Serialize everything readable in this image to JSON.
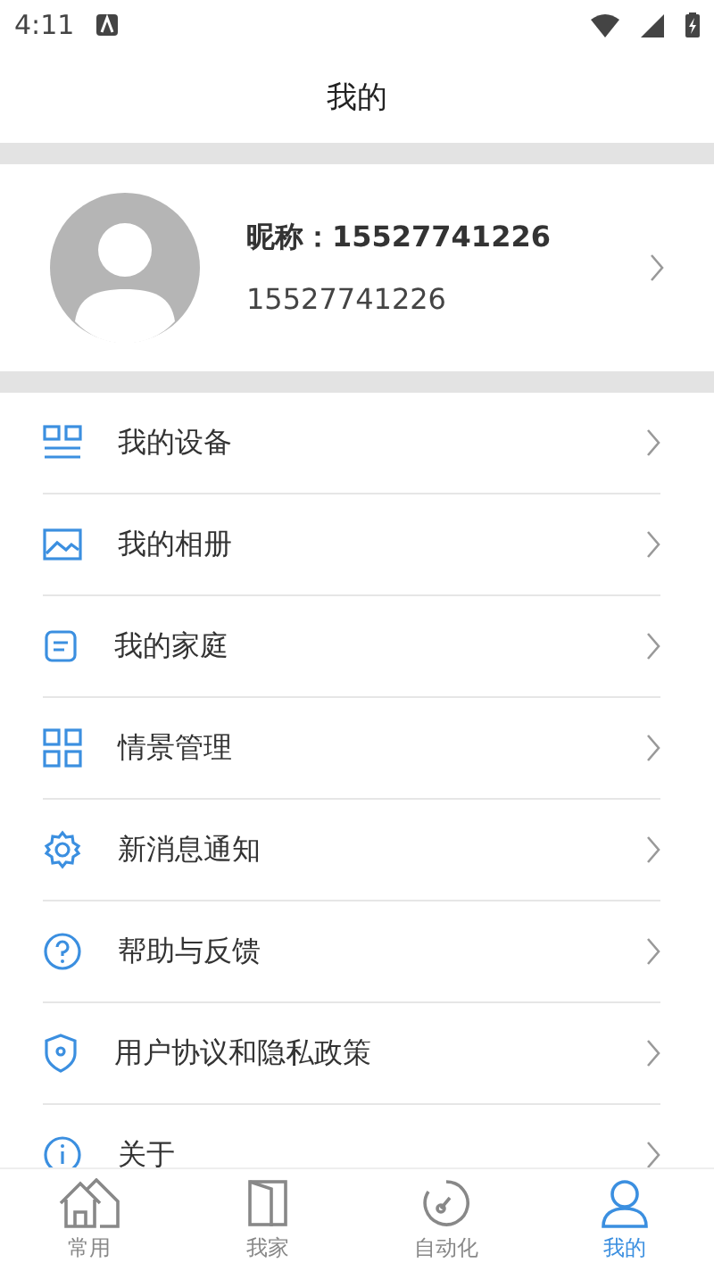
{
  "status_bar": {
    "time": "4:11"
  },
  "header": {
    "title": "我的"
  },
  "profile": {
    "nickname": "昵称：15527741226",
    "phone": "15527741226"
  },
  "menu": [
    {
      "kind": "devices",
      "label": "我的设备"
    },
    {
      "kind": "album",
      "label": "我的相册"
    },
    {
      "kind": "family",
      "label": "我的家庭"
    },
    {
      "kind": "scenes",
      "label": "情景管理"
    },
    {
      "kind": "notify",
      "label": "新消息通知"
    },
    {
      "kind": "help",
      "label": "帮助与反馈"
    },
    {
      "kind": "privacy",
      "label": "用户协议和隐私政策"
    },
    {
      "kind": "about",
      "label": "关于"
    }
  ],
  "tabs": [
    {
      "kind": "home",
      "label": "常用",
      "selected": false
    },
    {
      "kind": "door",
      "label": "我家",
      "selected": false
    },
    {
      "kind": "gauge",
      "label": "自动化",
      "selected": false
    },
    {
      "kind": "person",
      "label": "我的",
      "selected": true
    }
  ]
}
